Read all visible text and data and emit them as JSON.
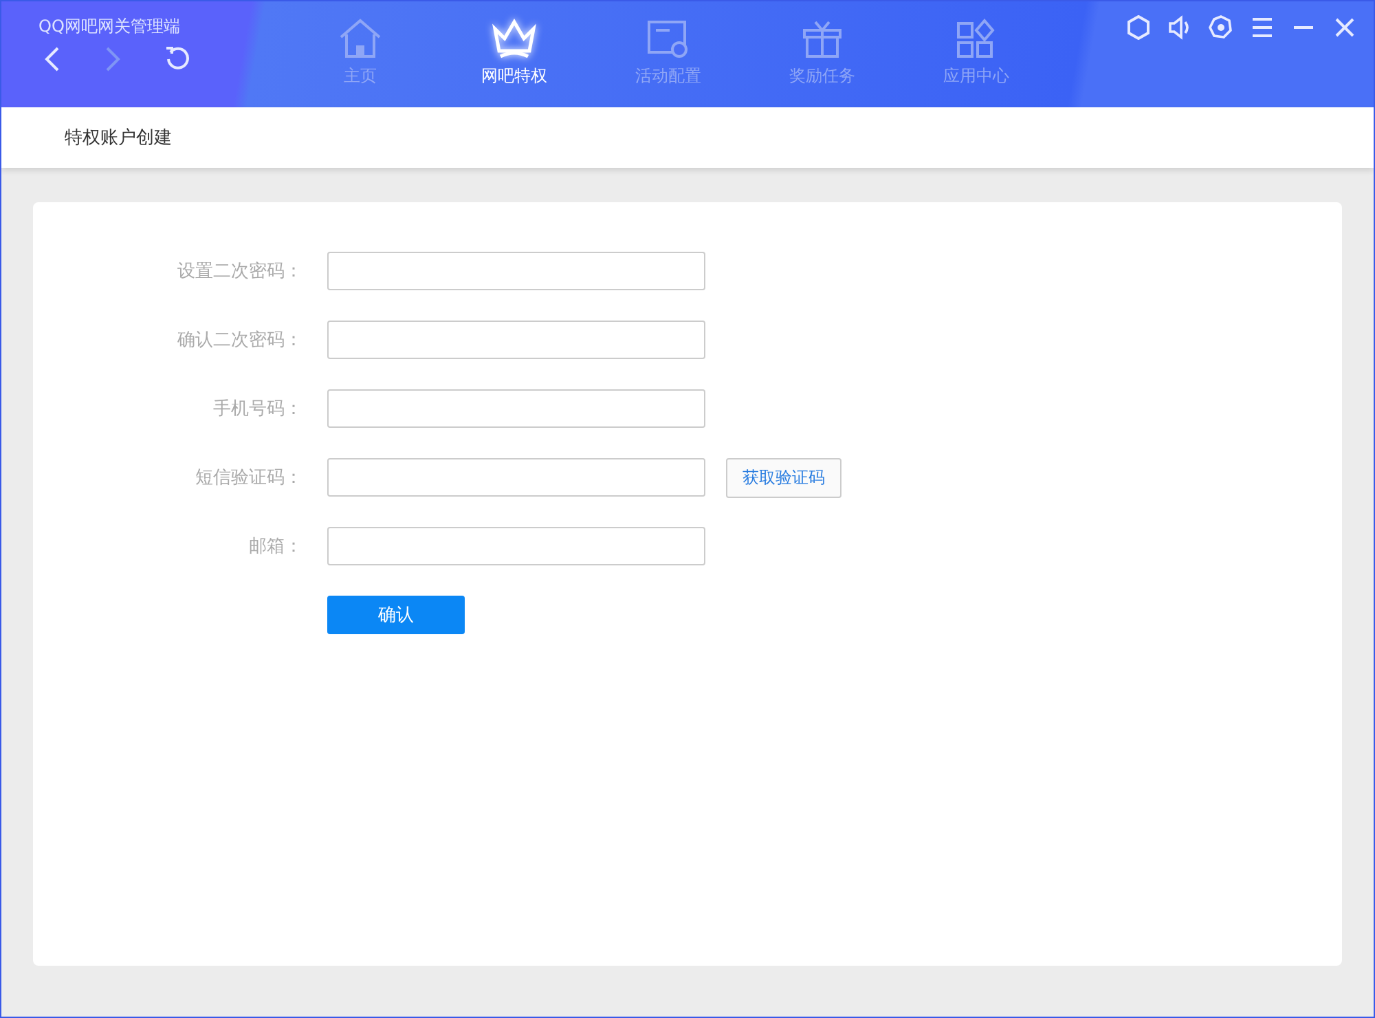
{
  "app_title": "QQ网吧网关管理端",
  "nav_buttons": [
    {
      "kind": "back",
      "disabled": false
    },
    {
      "kind": "forward",
      "disabled": true
    },
    {
      "kind": "refresh",
      "disabled": false
    }
  ],
  "tabs": [
    {
      "label": "主页",
      "kind": "home",
      "selected": false
    },
    {
      "label": "网吧特权",
      "kind": "crown",
      "selected": true
    },
    {
      "label": "活动配置",
      "kind": "config",
      "selected": false
    },
    {
      "label": "奖励任务",
      "kind": "gift",
      "selected": false
    },
    {
      "label": "应用中心",
      "kind": "apps",
      "selected": false
    }
  ],
  "window_controls": [
    {
      "kind": "hexagon"
    },
    {
      "kind": "sound"
    },
    {
      "kind": "settings"
    },
    {
      "kind": "menu"
    },
    {
      "kind": "minimize"
    },
    {
      "kind": "close"
    }
  ],
  "page_title": "特权账户创建",
  "form": {
    "fields": [
      {
        "label": "设置二次密码："
      },
      {
        "label": "确认二次密码："
      },
      {
        "label": "手机号码："
      },
      {
        "label": "短信验证码：",
        "button": "获取验证码"
      },
      {
        "label": "邮箱："
      }
    ],
    "submit": "确认"
  }
}
